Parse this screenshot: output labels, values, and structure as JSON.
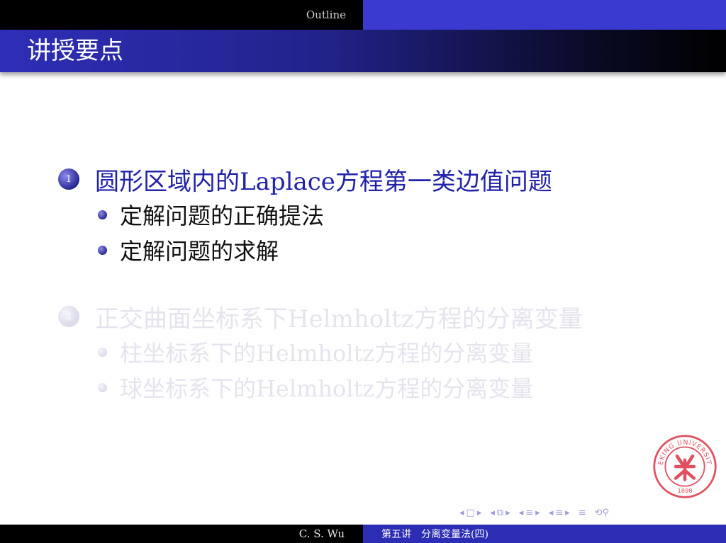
{
  "header": {
    "outline_label": "Outline"
  },
  "frame": {
    "title": "讲授要点"
  },
  "sections": [
    {
      "number": "1",
      "title": "圆形区域内的Laplace方程第一类边值问题",
      "items": [
        "定解问题的正确提法",
        "定解问题的求解"
      ]
    },
    {
      "number": "2",
      "title": "正交曲面坐标系下Helmholtz方程的分离变量",
      "items": [
        "柱坐标系下的Helmholtz方程的分离变量",
        "球坐标系下的Helmholtz方程的分离变量"
      ]
    }
  ],
  "footer": {
    "author": "C. S. Wu",
    "lecture": "第五讲　分离变量法(四)"
  },
  "seal": {
    "text_top": "PEKING UNIVERSITY",
    "year": "1898"
  },
  "colors": {
    "accent": "#2222aa",
    "seal": "#e05060",
    "dim": "#e4e4ee"
  }
}
